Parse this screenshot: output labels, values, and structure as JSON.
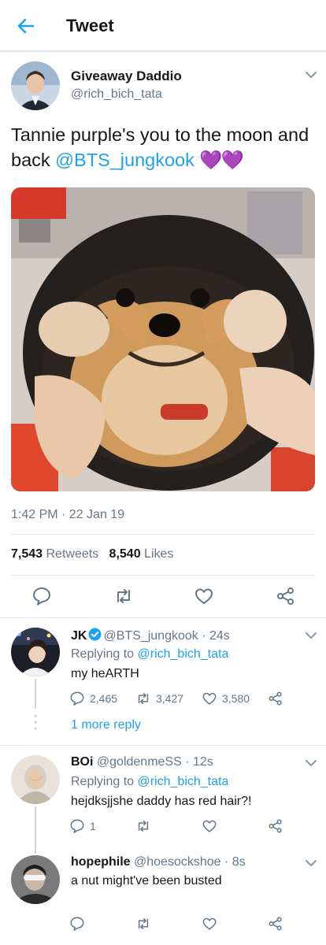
{
  "header": {
    "title": "Tweet"
  },
  "tweet": {
    "name": "Giveaway Daddio",
    "handle": "@rich_bich_tata",
    "text_before": "Tannie purple's you to the moon and back ",
    "mention": "@BTS_jungkook",
    "emoji": "💜💜",
    "time": "1:42 PM · 22 Jan 19",
    "retweets_count": "7,543",
    "retweets_label": "Retweets",
    "likes_count": "8,540",
    "likes_label": "Likes"
  },
  "replies": [
    {
      "name": "JK",
      "verified": true,
      "handle": "@BTS_jungkook",
      "time": "· 24s",
      "replying_prefix": "Replying to ",
      "replying_to": "@rich_bich_tata",
      "text": "my heARTH",
      "reply_count": "2,465",
      "retweet_count": "3,427",
      "like_count": "3,580",
      "more_replies": "1 more reply"
    },
    {
      "name": "BOi",
      "handle": "@goldenmeSS",
      "time": "· 12s",
      "replying_prefix": "Replying to ",
      "replying_to": "@rich_bich_tata",
      "text": "hejdksjjshe daddy has red hair?!",
      "reply_count": "1",
      "retweet_count": "",
      "like_count": ""
    },
    {
      "name": "hopephile",
      "handle": "@hoesockshoe",
      "time": "· 8s",
      "text": "a nut might've been busted",
      "reply_count": "",
      "retweet_count": "",
      "like_count": ""
    }
  ],
  "colors": {
    "accent": "#1da1f2",
    "secondary": "#657786",
    "divider": "#e1e8ed",
    "heart_emoji": "#b23ce8"
  }
}
